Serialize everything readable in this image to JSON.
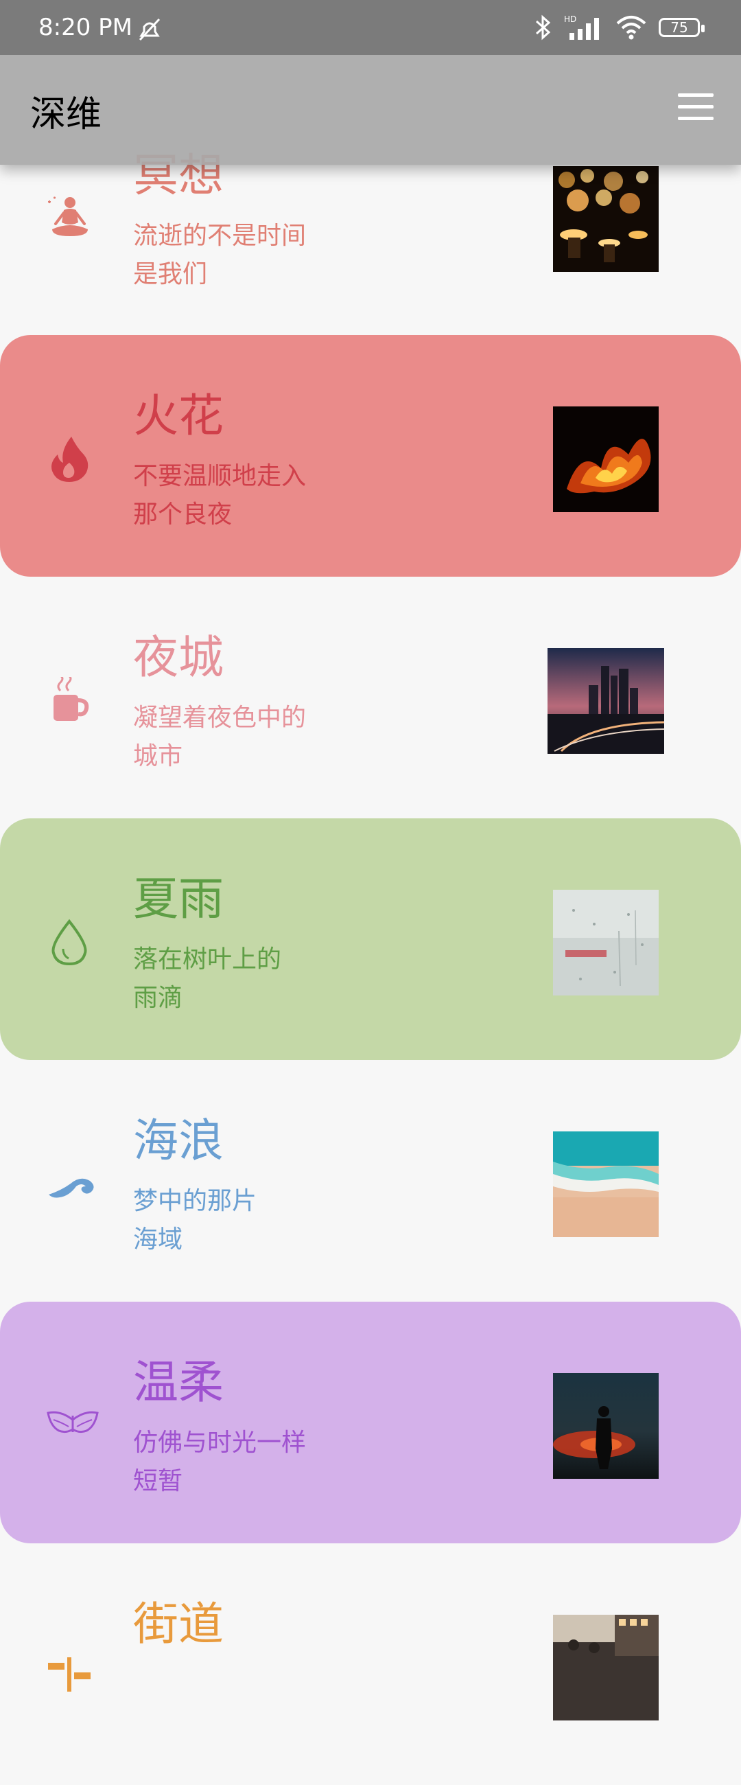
{
  "status_bar": {
    "time": "8:20 PM",
    "battery": "75",
    "icons": [
      "alarm-off-icon",
      "bluetooth-icon",
      "hd-signal-icon",
      "wifi-icon",
      "battery-icon"
    ]
  },
  "app_bar": {
    "title": "深维",
    "menu_icon": "hamburger-menu-icon"
  },
  "items": [
    {
      "title": "冥想",
      "line1": "流逝的不是时间",
      "line2": "是我们",
      "color": "#e07f73",
      "background": "transparent",
      "icon": "meditation-icon",
      "image": "candles-photo"
    },
    {
      "title": "火花",
      "line1": "不要温顺地走入",
      "line2": "那个良夜",
      "color": "#d03f4a",
      "background": "#ea8b8a",
      "icon": "flame-icon",
      "image": "fire-photo"
    },
    {
      "title": "夜城",
      "line1": "凝望着夜色中的",
      "line2": "城市",
      "color": "#e6929a",
      "background": "transparent",
      "icon": "coffee-cup-icon",
      "image": "city-night-photo"
    },
    {
      "title": "夏雨",
      "line1": "落在树叶上的",
      "line2": "雨滴",
      "color": "#5e9e45",
      "background": "#c4d8a7",
      "icon": "water-drop-icon",
      "image": "rainy-window-photo"
    },
    {
      "title": "海浪",
      "line1": "梦中的那片",
      "line2": "海域",
      "color": "#6a9fd2",
      "background": "transparent",
      "icon": "wave-icon",
      "image": "beach-aerial-photo"
    },
    {
      "title": "温柔",
      "line1": "仿佛与时光一样",
      "line2": "短暂",
      "color": "#9f52d0",
      "background": "#d4b1ea",
      "icon": "butterfly-icon",
      "image": "silhouette-photo"
    },
    {
      "title": "街道",
      "line1": "",
      "line2": "",
      "color": "#e89a3c",
      "background": "transparent",
      "icon": "signpost-icon",
      "image": "street-photo"
    }
  ]
}
